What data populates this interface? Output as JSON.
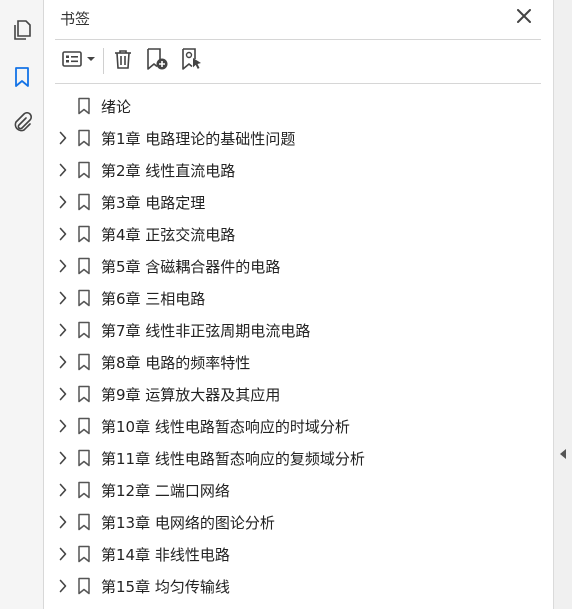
{
  "panel": {
    "title": "书签",
    "close_icon": "close-icon"
  },
  "left_rail": {
    "items": [
      {
        "icon": "pages-icon"
      },
      {
        "icon": "bookmark-icon",
        "active": true
      },
      {
        "icon": "attachment-icon"
      }
    ]
  },
  "toolbar": {
    "icons": [
      "options-menu-icon",
      "delete-icon",
      "new-bookmark-icon",
      "bookmark-from-selection-icon"
    ]
  },
  "bookmarks": [
    {
      "label": "绪论",
      "expandable": false
    },
    {
      "label": "第1章  电路理论的基础性问题",
      "expandable": true
    },
    {
      "label": "第2章  线性直流电路",
      "expandable": true
    },
    {
      "label": "第3章  电路定理",
      "expandable": true
    },
    {
      "label": "第4章  正弦交流电路",
      "expandable": true
    },
    {
      "label": "第5章  含磁耦合器件的电路",
      "expandable": true
    },
    {
      "label": "第6章  三相电路",
      "expandable": true
    },
    {
      "label": "第7章  线性非正弦周期电流电路",
      "expandable": true
    },
    {
      "label": "第8章  电路的频率特性",
      "expandable": true
    },
    {
      "label": "第9章  运算放大器及其应用",
      "expandable": true
    },
    {
      "label": "第10章  线性电路暂态响应的时域分析",
      "expandable": true
    },
    {
      "label": "第11章  线性电路暂态响应的复频域分析",
      "expandable": true
    },
    {
      "label": "第12章  二端口网络",
      "expandable": true
    },
    {
      "label": "第13章  电网络的图论分析",
      "expandable": true
    },
    {
      "label": "第14章  非线性电路",
      "expandable": true
    },
    {
      "label": "第15章  均匀传输线",
      "expandable": true
    }
  ],
  "colors": {
    "accent": "#1473e6",
    "icon": "#444444"
  }
}
